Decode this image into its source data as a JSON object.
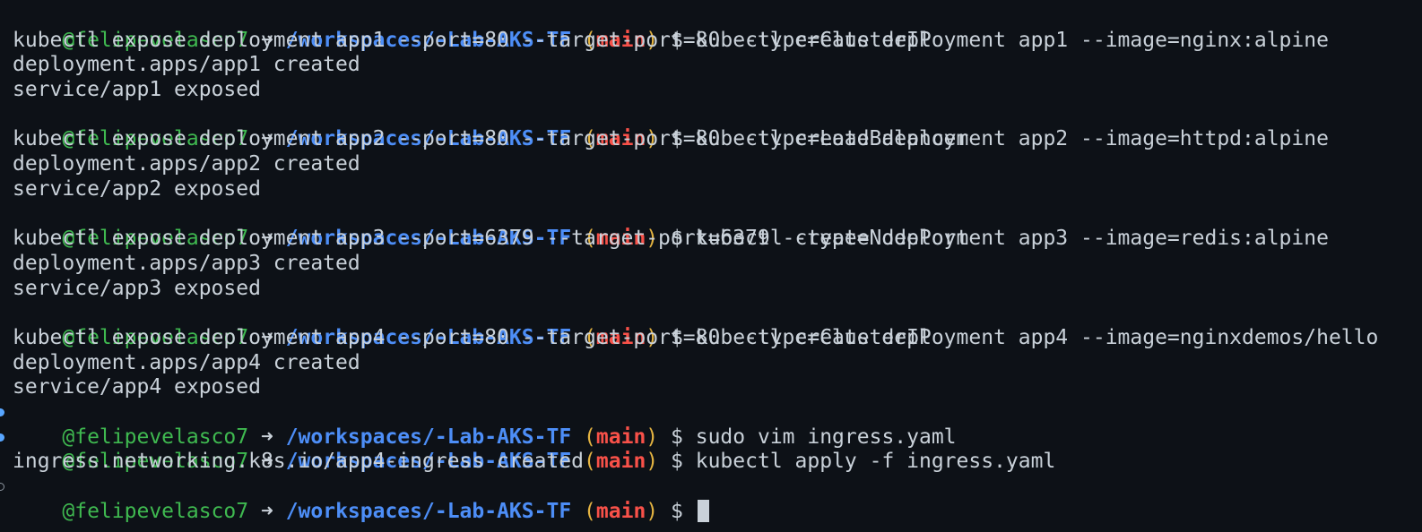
{
  "prompt": {
    "user": "@felipevelasco7",
    "arrow": "➜",
    "path": "/workspaces/-Lab-AKS-TF",
    "open_paren": "(",
    "branch": "main",
    "close_paren": ")",
    "dollar": "$"
  },
  "blocks": [
    {
      "command": "kubectl create deployment app1 --image=nginx:alpine",
      "output": [
        "kubectl expose deployment app1 --port=80 --target-port=80 --type=ClusterIP",
        "deployment.apps/app1 created",
        "service/app1 exposed"
      ]
    },
    {
      "command": "kubectl create deployment app2 --image=httpd:alpine",
      "output": [
        "kubectl expose deployment app2 --port=80 --target-port=80 --type=LoadBalancer",
        "deployment.apps/app2 created",
        "service/app2 exposed"
      ]
    },
    {
      "command": "kubectl create deployment app3 --image=redis:alpine",
      "output": [
        "kubectl expose deployment app3 --port=6379 --target-port=6379 --type=NodePort",
        "deployment.apps/app3 created",
        "service/app3 exposed"
      ]
    },
    {
      "command": "kubectl create deployment app4 --image=nginxdemos/hello",
      "output": [
        "kubectl expose deployment app4 --port=80 --target-port=80 --type=ClusterIP",
        "deployment.apps/app4 created",
        "service/app4 exposed"
      ]
    },
    {
      "command": "sudo vim ingress.yaml",
      "output": []
    },
    {
      "command": "kubectl apply -f ingress.yaml",
      "output": [
        "ingress.networking.k8s.io/app4-ingress created"
      ]
    }
  ],
  "current_command": ""
}
